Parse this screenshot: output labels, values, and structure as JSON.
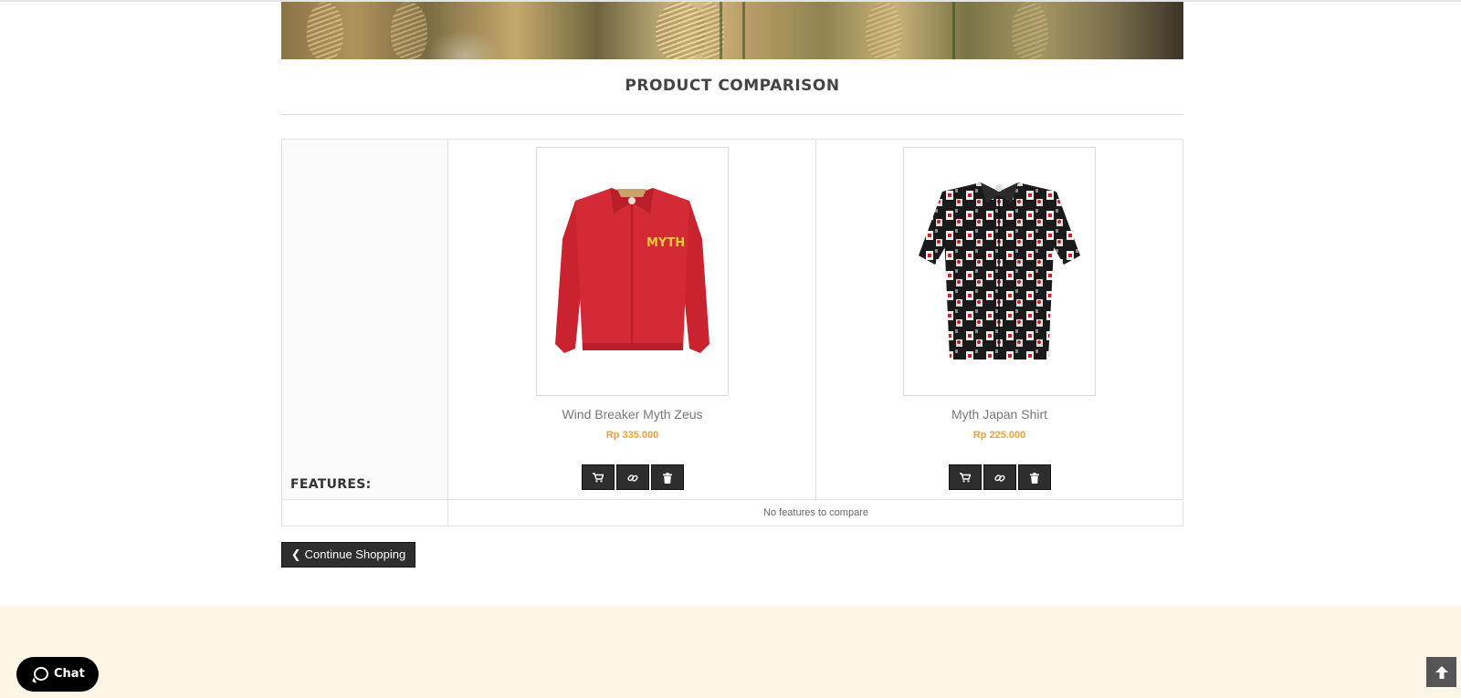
{
  "page": {
    "title": "PRODUCT COMPARISON",
    "features_label": "FEATURES:",
    "no_features_text": "No features to compare",
    "continue_label": "Continue Shopping"
  },
  "products": [
    {
      "name": "Wind Breaker Myth Zeus",
      "price": "Rp 335.000",
      "image_icon": "red-jacket-image",
      "logo_text": "MYTH",
      "actions": [
        "cart-icon",
        "link-icon",
        "trash-icon"
      ]
    },
    {
      "name": "Myth Japan Shirt",
      "price": "Rp 225.000",
      "image_icon": "patterned-shirt-image",
      "actions": [
        "cart-icon",
        "link-icon",
        "trash-icon"
      ]
    }
  ],
  "chat": {
    "label": "Chat"
  },
  "colors": {
    "price": "#e8a33d",
    "button": "#2e2e2e",
    "footer": "#fdf5e6",
    "jacket": "#d42a35"
  }
}
